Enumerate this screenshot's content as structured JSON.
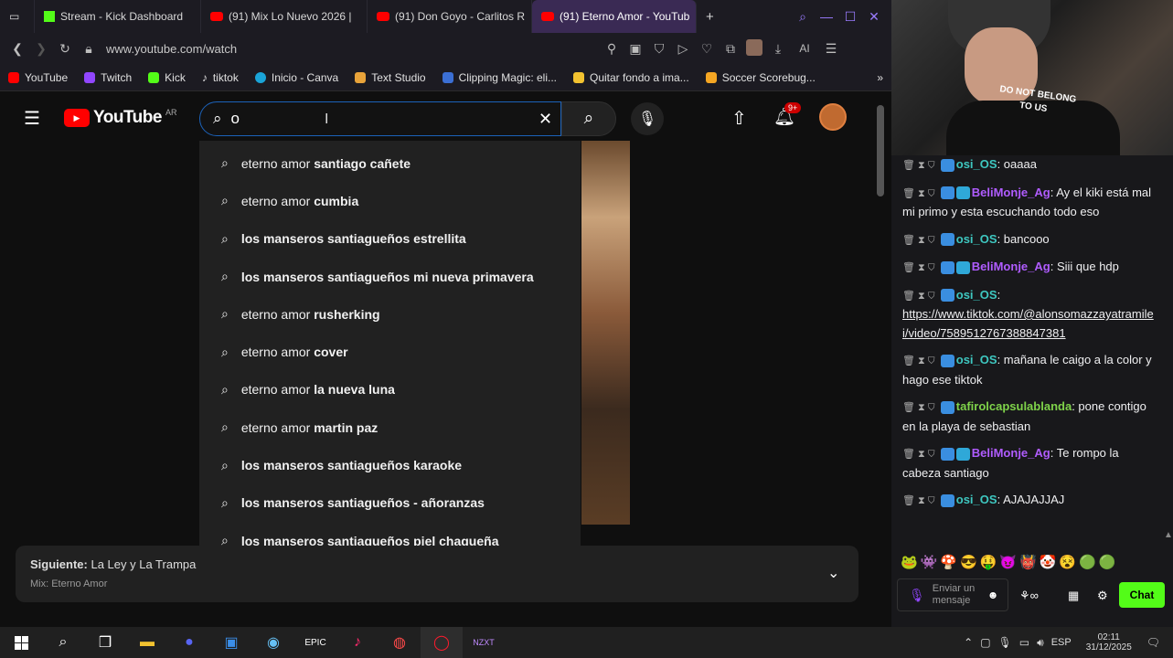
{
  "browser": {
    "tabs": [
      {
        "label": "Stream - Kick Dashboard",
        "icon": "kick-icon"
      },
      {
        "label": "(91) Mix Lo Nuevo 2026 | ",
        "icon": "youtube-icon"
      },
      {
        "label": "(91) Don Goyo - Carlitos R",
        "icon": "youtube-icon"
      },
      {
        "label": "(91) Eterno Amor - YouTub",
        "icon": "youtube-icon",
        "active": true
      }
    ],
    "url": "www.youtube.com/watch",
    "bookmarks": [
      {
        "label": "YouTube",
        "color": "#ff0000"
      },
      {
        "label": "Twitch",
        "color": "#9146ff"
      },
      {
        "label": "Kick",
        "color": "#53fc18"
      },
      {
        "label": "tiktok",
        "color": "#ffffff"
      },
      {
        "label": "Inicio - Canva",
        "color": "#1aa4d8"
      },
      {
        "label": "Text Studio",
        "color": "#e8a33a"
      },
      {
        "label": "Clipping Magic: eli...",
        "color": "#3b6fd4"
      },
      {
        "label": "Quitar fondo a ima...",
        "color": "#f2c230"
      },
      {
        "label": "Soccer Scorebug...",
        "color": "#f5a623"
      }
    ],
    "ai_label": "AI"
  },
  "youtube": {
    "logo_text": "YouTube",
    "country": "AR",
    "search_value": "o",
    "notification_count": "9+",
    "suggestions": [
      {
        "prefix": "eterno amor ",
        "bold": "santiago cañete"
      },
      {
        "prefix": "eterno amor ",
        "bold": "cumbia"
      },
      {
        "prefix": "",
        "bold": "los manseros santiagueños estrellita"
      },
      {
        "prefix": "",
        "bold": "los manseros santiagueños mi nueva primavera"
      },
      {
        "prefix": "eterno amor ",
        "bold": "rusherking"
      },
      {
        "prefix": "eterno amor ",
        "bold": "cover"
      },
      {
        "prefix": "eterno amor ",
        "bold": "la nueva luna"
      },
      {
        "prefix": "eterno amor ",
        "bold": "martin paz"
      },
      {
        "prefix": "",
        "bold": "los manseros santiagueños karaoke"
      },
      {
        "prefix": "",
        "bold": "los manseros santiagueños - añoranzas"
      },
      {
        "prefix": "",
        "bold": "los manseros santiagueños piel chaqueña"
      }
    ],
    "next": {
      "label": "Siguiente:",
      "title": "La Ley y La Trampa",
      "mix": "Mix: Eterno Amor"
    }
  },
  "chat": {
    "messages": [
      {
        "user": "osi_OS",
        "ucls": "u1",
        "text": ": oaaaa"
      },
      {
        "user": "BeliMonje_Ag",
        "ucls": "u2",
        "text": ": Ay el kiki está mal mi primo y esta escuchando todo eso"
      },
      {
        "user": "osi_OS",
        "ucls": "u1",
        "text": ": bancooo"
      },
      {
        "user": "BeliMonje_Ag",
        "ucls": "u2",
        "text": ": Siii que hdp"
      },
      {
        "user": "osi_OS",
        "ucls": "u1",
        "text": ":",
        "link": "https://www.tiktok.com/@alonsomazzayatramilei/video/7589512767388847381"
      },
      {
        "user": "osi_OS",
        "ucls": "u1",
        "text": ": mañana le caigo a la color y hago ese tiktok"
      },
      {
        "user": "tafirolcapsulablanda",
        "ucls": "u3",
        "text": ": pone contigo en la playa de sebastian"
      },
      {
        "user": "BeliMonje_Ag",
        "ucls": "u2",
        "text": ": Te rompo la cabeza santiago"
      },
      {
        "user": "osi_OS",
        "ucls": "u1",
        "text": ": AJAJAJJAJ"
      }
    ],
    "input_placeholder": "Enviar un mensaje",
    "send_label": "Chat",
    "accent": "#53fc18"
  },
  "cam": {
    "shirt_text_1": "DO NOT BELONG",
    "shirt_text_2": "TO US"
  },
  "taskbar": {
    "language": "ESP",
    "time": "02:11",
    "date": "31/12/2025"
  }
}
